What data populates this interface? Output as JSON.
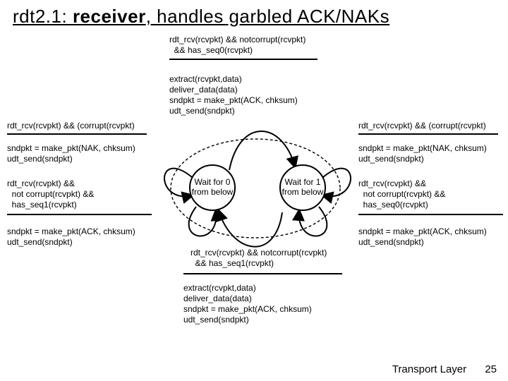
{
  "title": {
    "part1": "rdt2.1: ",
    "receiver": "receiver",
    "part2": ", handles garbled ACK/NAKs"
  },
  "top_event": "rdt_rcv(rcvpkt) && notcorrupt(rcvpkt)\n  && has_seq0(rcvpkt)",
  "top_action": "extract(rcvpkt,data)\ndeliver_data(data)\nsndpkt = make_pkt(ACK, chksum)\nudt_send(sndpkt)",
  "left_corrupt": "rdt_rcv(rcvpkt) && (corrupt(rcvpkt)",
  "right_corrupt": "rdt_rcv(rcvpkt) && (corrupt(rcvpkt)",
  "nak_action_left": "sndpkt = make_pkt(NAK, chksum)\nudt_send(sndpkt)",
  "nak_action_right": "sndpkt = make_pkt(NAK, chksum)\nudt_send(sndpkt)",
  "dup_event_left": "rdt_rcv(rcvpkt) &&\n  not corrupt(rcvpkt) &&\n  has_seq1(rcvpkt)",
  "dup_event_right": "rdt_rcv(rcvpkt) &&\n  not corrupt(rcvpkt) &&\n  has_seq0(rcvpkt)",
  "ack_action_left": "sndpkt = make_pkt(ACK, chksum)\nudt_send(sndpkt)",
  "ack_action_right": "sndpkt = make_pkt(ACK, chksum)\nudt_send(sndpkt)",
  "bottom_event": "rdt_rcv(rcvpkt) && notcorrupt(rcvpkt)\n  && has_seq1(rcvpkt)",
  "bottom_action": "extract(rcvpkt,data)\ndeliver_data(data)\nsndpkt = make_pkt(ACK, chksum)\nudt_send(sndpkt)",
  "state0": "Wait for\n0 from\nbelow",
  "state1": "Wait for\n1 from\nbelow",
  "footer_label": "Transport Layer",
  "footer_page": "25"
}
